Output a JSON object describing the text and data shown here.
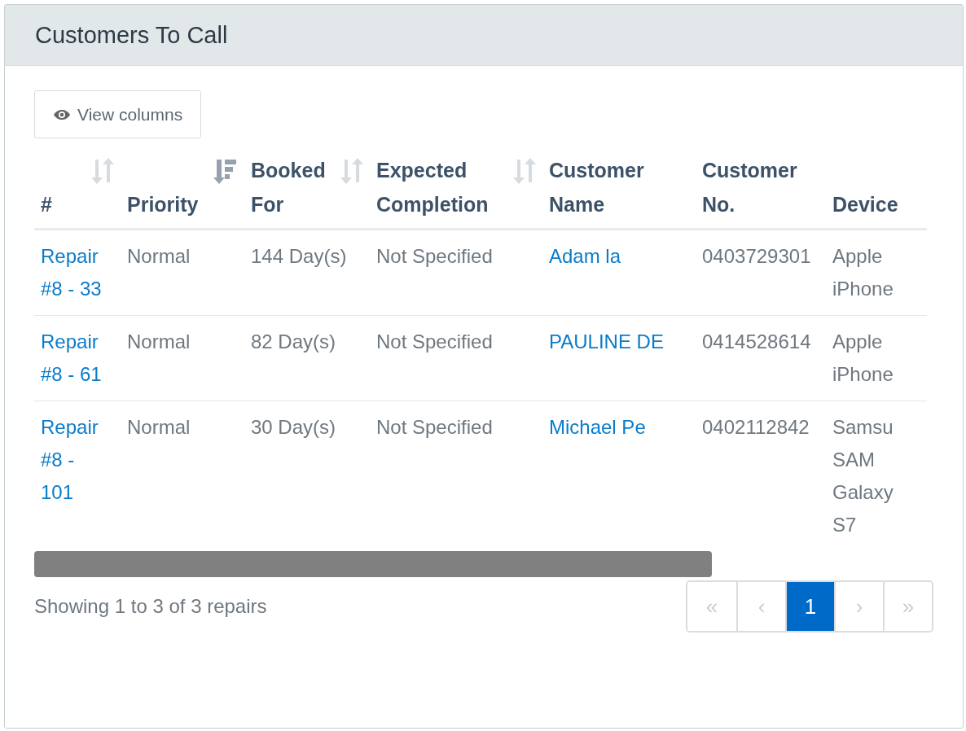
{
  "panel": {
    "title": "Customers To Call"
  },
  "view_columns_button": {
    "label": "View columns"
  },
  "table": {
    "columns": [
      {
        "label": "#",
        "sortable": true,
        "sorted": false
      },
      {
        "label": "Priority",
        "sortable": true,
        "sorted": true
      },
      {
        "label": "Booked For",
        "sortable": true,
        "sorted": false
      },
      {
        "label": "Expected Completion",
        "sortable": true,
        "sorted": false
      },
      {
        "label": "Customer Name",
        "sortable": false
      },
      {
        "label": "Customer No.",
        "sortable": false
      },
      {
        "label": "Device",
        "sortable": false
      }
    ],
    "rows": [
      {
        "repair": "Repair #8 - 33",
        "priority": "Normal",
        "booked_for": "144 Day(s)",
        "expected_completion": "Not Specified",
        "customer_name": "Adam la",
        "customer_no": "0403729301",
        "device": "Apple iPhone"
      },
      {
        "repair": "Repair #8 - 61",
        "priority": "Normal",
        "booked_for": "82 Day(s)",
        "expected_completion": "Not Specified",
        "customer_name": "PAULINE DE",
        "customer_no": "0414528614",
        "device": "Apple iPhone"
      },
      {
        "repair": "Repair #8 - 101",
        "priority": "Normal",
        "booked_for": "30 Day(s)",
        "expected_completion": "Not Specified",
        "customer_name": "Michael Pe",
        "customer_no": "0402112842",
        "device": "Samsu SAM Galaxy S7"
      }
    ]
  },
  "summary": "Showing 1 to 3 of 3 repairs",
  "pagination": [
    {
      "label": "«",
      "selected": false,
      "disabled": true
    },
    {
      "label": "‹",
      "selected": false,
      "disabled": true
    },
    {
      "label": "1",
      "selected": true,
      "disabled": false
    },
    {
      "label": "›",
      "selected": false,
      "disabled": true
    },
    {
      "label": "»",
      "selected": false,
      "disabled": true
    }
  ]
}
